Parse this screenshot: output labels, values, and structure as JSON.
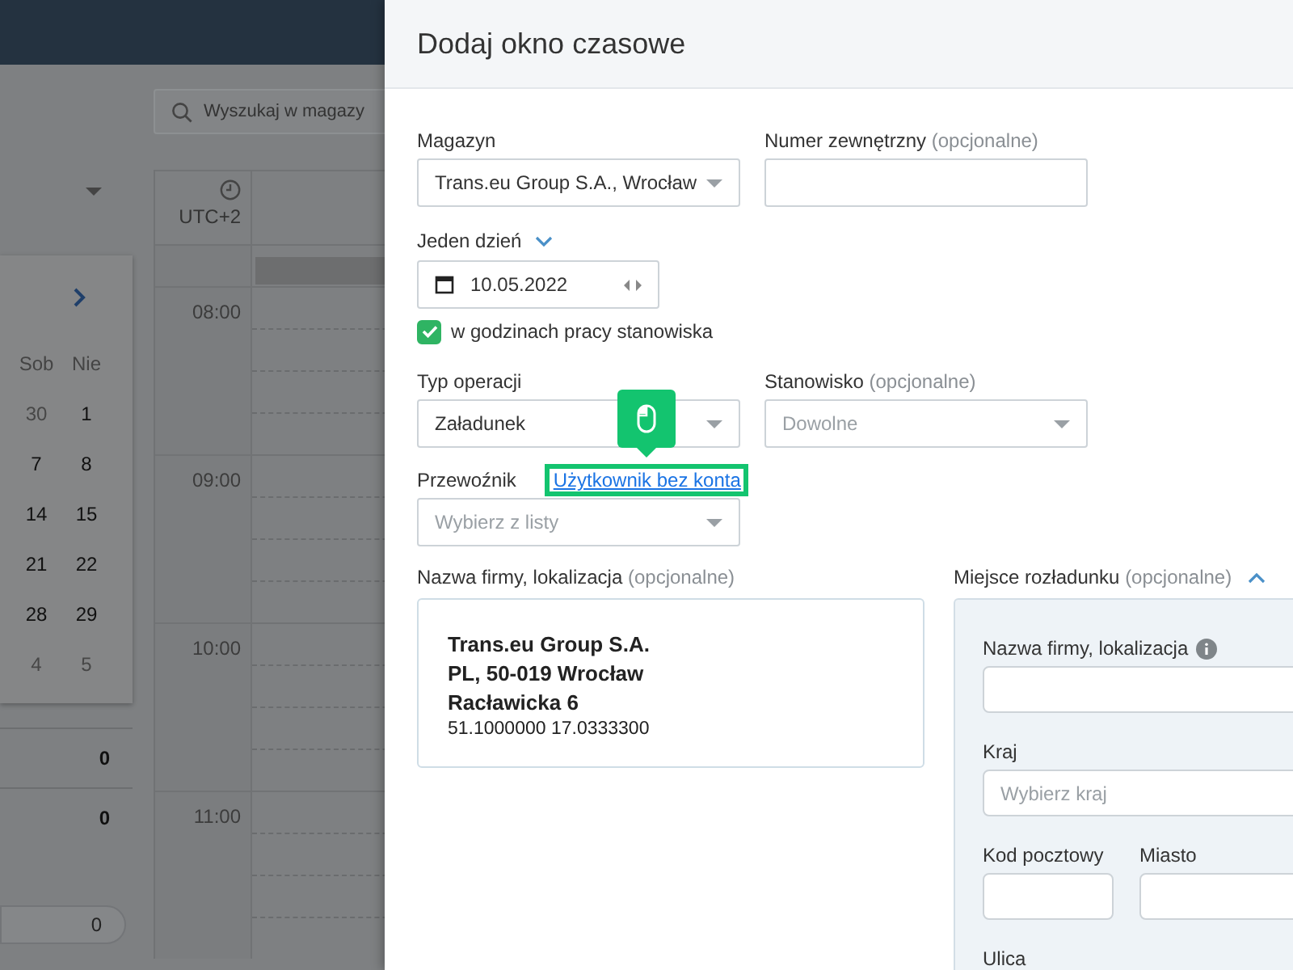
{
  "background": {
    "search_placeholder": "Wyszukaj w magazy",
    "calendar": {
      "weekdays": [
        "Sob",
        "Nie"
      ],
      "weeks": [
        [
          {
            "day": "30",
            "muted": true
          },
          {
            "day": "1",
            "muted": false
          }
        ],
        [
          {
            "day": "7",
            "muted": false
          },
          {
            "day": "8",
            "muted": false
          }
        ],
        [
          {
            "day": "14",
            "muted": false
          },
          {
            "day": "15",
            "muted": false
          }
        ],
        [
          {
            "day": "21",
            "muted": false
          },
          {
            "day": "22",
            "muted": false
          }
        ],
        [
          {
            "day": "28",
            "muted": false
          },
          {
            "day": "29",
            "muted": false
          }
        ],
        [
          {
            "day": "4",
            "muted": true
          },
          {
            "day": "5",
            "muted": true
          }
        ]
      ]
    },
    "summary": [
      "0",
      "0"
    ],
    "pills": [
      "0"
    ],
    "timezone": "UTC+2",
    "hours": [
      "08:00",
      "09:00",
      "10:00",
      "11:00"
    ]
  },
  "dialog": {
    "title": "Dodaj okno czasowe",
    "warehouse": {
      "label": "Magazyn",
      "value": "Trans.eu Group S.A., Wrocław"
    },
    "external_number": {
      "label": "Numer zewnętrzny",
      "optional": "(opcjonalne)"
    },
    "date_mode": {
      "label": "Jeden dzień",
      "expanded": false
    },
    "date": {
      "value": "10.05.2022"
    },
    "work_hours": {
      "label": "w godzinach pracy stanowiska",
      "checked": true
    },
    "operation_type": {
      "label": "Typ operacji",
      "value": "Załadunek"
    },
    "station": {
      "label": "Stanowisko",
      "optional": "(opcjonalne)",
      "placeholder": "Dowolne"
    },
    "carrier": {
      "label": "Przewoźnik",
      "link": "Użytkownik bez konta",
      "placeholder": "Wybierz z listy",
      "highlighted": true
    },
    "company": {
      "label": "Nazwa firmy, lokalizacja",
      "optional": "(opcjonalne)",
      "lines": [
        "Trans.eu Group S.A.",
        "PL, 50-019 Wrocław",
        "Racławicka 6"
      ],
      "coords": "51.1000000 17.0333300"
    },
    "unloading": {
      "label": "Miejsce rozładunku",
      "optional": "(opcjonalne)",
      "expanded": true,
      "name_label": "Nazwa firmy, lokalizacja",
      "country_label": "Kraj",
      "country_placeholder": "Wybierz kraj",
      "postal_label": "Kod pocztowy",
      "city_label": "Miasto",
      "street_label": "Ulica"
    }
  }
}
